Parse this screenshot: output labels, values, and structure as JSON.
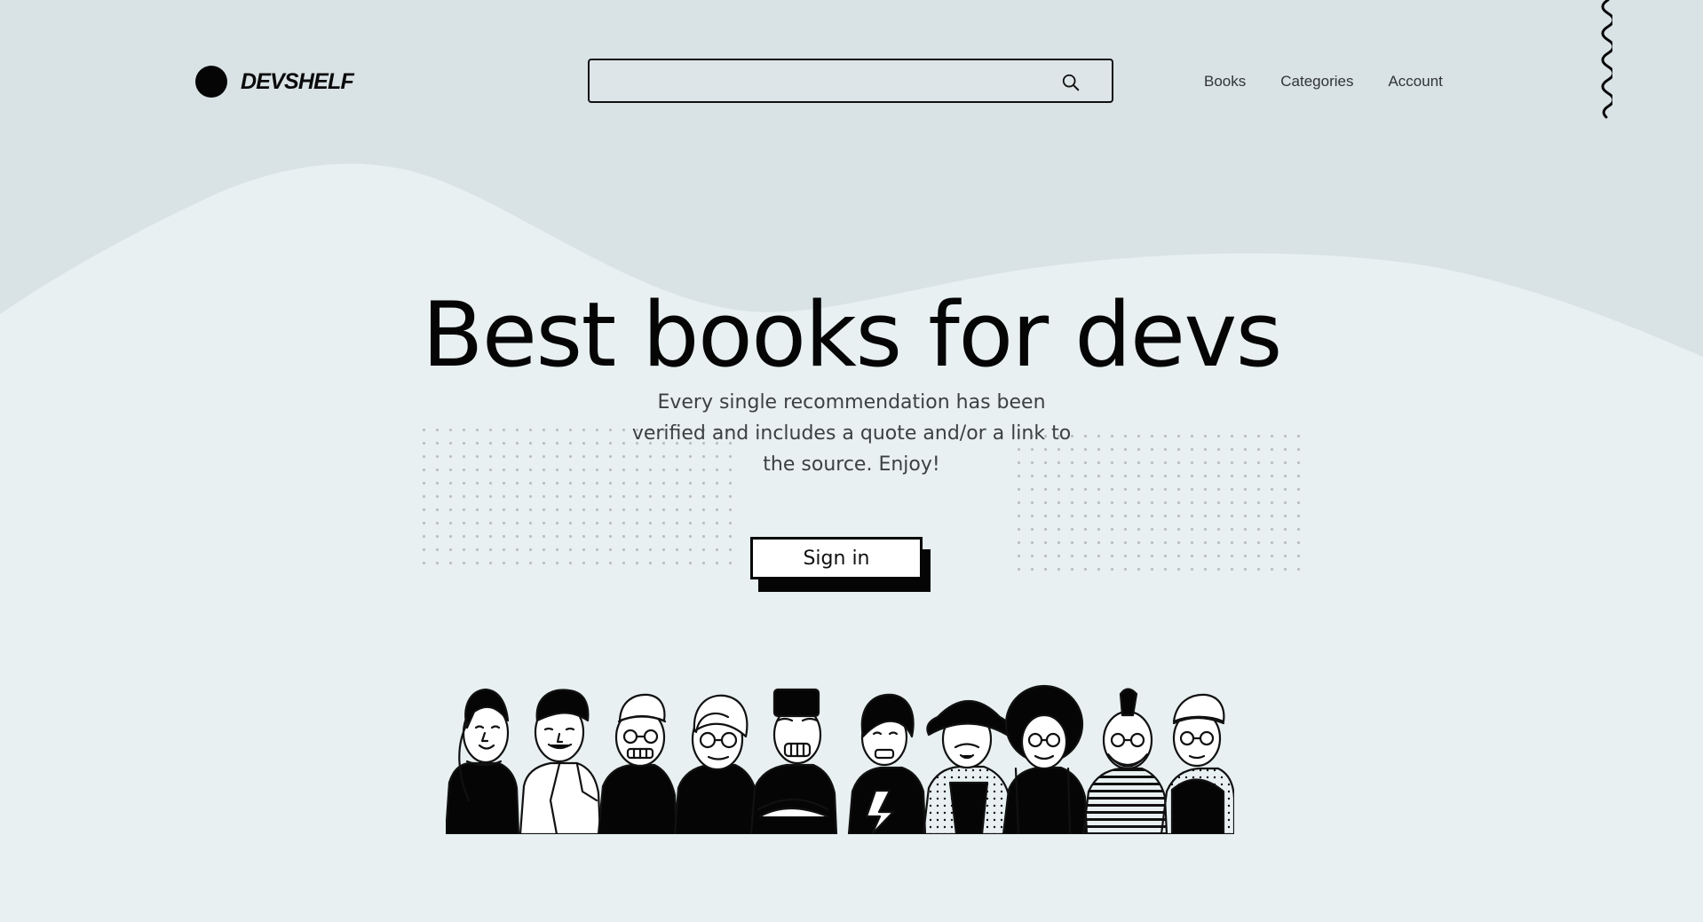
{
  "brand": {
    "name": "DEVSHELF",
    "logo_icon": "solid-circle-logo"
  },
  "search": {
    "value": "",
    "placeholder": "",
    "icon": "search-icon"
  },
  "nav": {
    "items": [
      {
        "label": "Books"
      },
      {
        "label": "Categories"
      },
      {
        "label": "Account"
      }
    ]
  },
  "hero": {
    "title": "Best books for devs",
    "subtitle": "Every single recommendation has been verified and includes a quote and/or a link to the source. Enjoy!",
    "button_label": "Sign in"
  },
  "illustration": {
    "name": "group-of-developers-illustration"
  },
  "colors": {
    "background": "#e8f0f1",
    "header_background": "#d9e2e5",
    "text": "#0b0b0b",
    "accent": "#050505"
  }
}
